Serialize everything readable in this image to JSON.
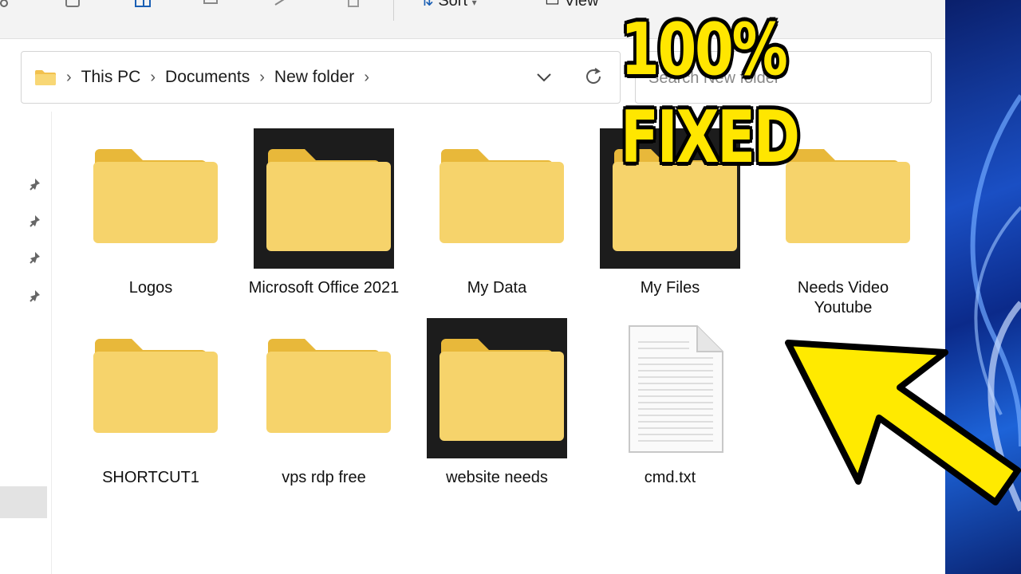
{
  "toolbar": {
    "sort_label": "Sort",
    "view_label": "View"
  },
  "address": {
    "crumbs": [
      "This PC",
      "Documents",
      "New folder"
    ]
  },
  "search": {
    "placeholder": "Search New folder"
  },
  "files": [
    {
      "name": "Logos",
      "type": "folder",
      "highlighted": false
    },
    {
      "name": "Microsoft Office 2021",
      "type": "folder",
      "highlighted": true
    },
    {
      "name": "My Data",
      "type": "folder",
      "highlighted": false
    },
    {
      "name": "My Files",
      "type": "folder",
      "highlighted": true
    },
    {
      "name": "Needs Video Youtube",
      "type": "folder",
      "highlighted": false
    },
    {
      "name": "SHORTCUT1",
      "type": "folder",
      "highlighted": false
    },
    {
      "name": "vps rdp free",
      "type": "folder",
      "highlighted": false
    },
    {
      "name": "website needs",
      "type": "folder",
      "highlighted": true
    },
    {
      "name": "cmd.txt",
      "type": "text-file",
      "highlighted": false
    }
  ],
  "overlay": {
    "headline": "100% FIXED",
    "arrow_color": "#ffea00"
  },
  "colors": {
    "folder_body": "#f6d36b",
    "folder_tab": "#e8b83a",
    "highlight_bg": "#1c1c1c"
  }
}
